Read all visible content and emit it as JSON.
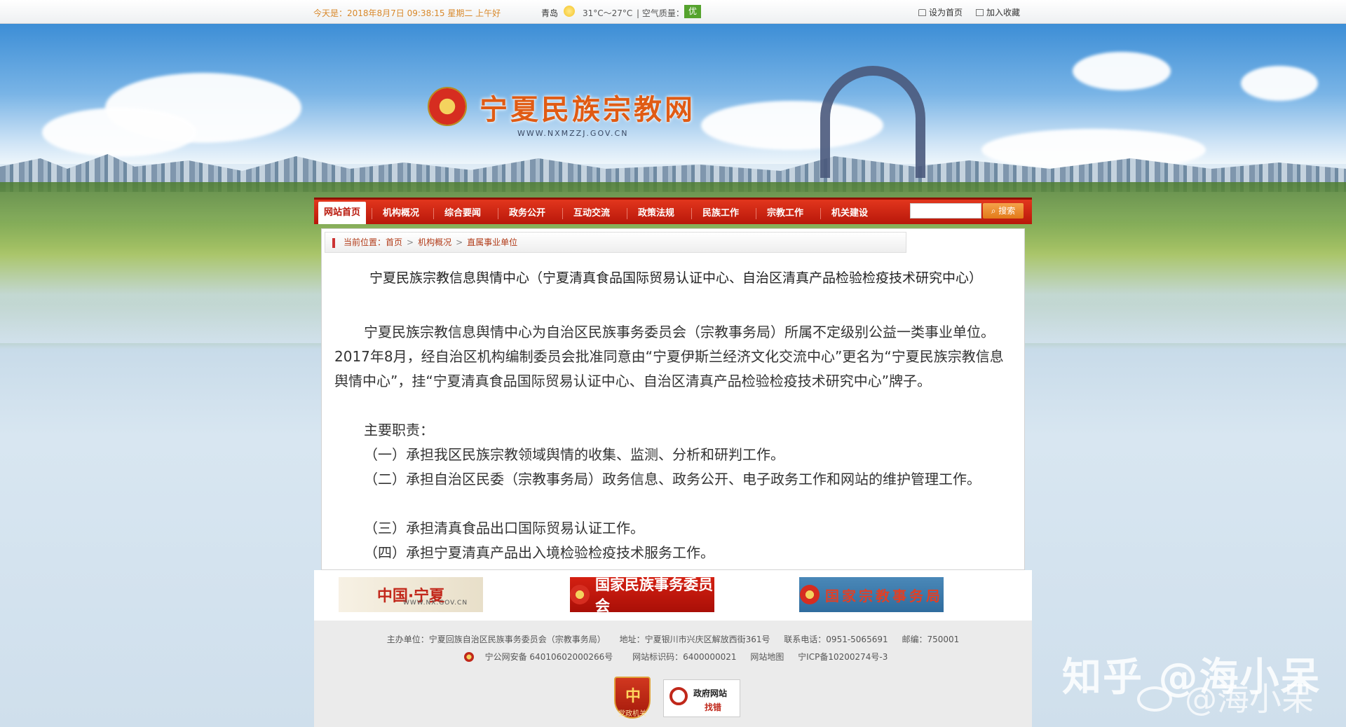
{
  "topbar": {
    "date": "今天是：2018年8月7日 09:38:15 星期二 上午好",
    "city": "青岛",
    "temperature": "31°C～27°C",
    "air_quality_label": "| 空气质量：",
    "air_quality_value": "优",
    "set_home": "设为首页",
    "add_favorite": "加入收藏"
  },
  "header": {
    "site_title": "宁夏民族宗教网",
    "site_url": "WWW.NXMZZJ.GOV.CN"
  },
  "nav": {
    "items": [
      "网站首页",
      "机构概况",
      "综合要闻",
      "政务公开",
      "互动交流",
      "政策法规",
      "民族工作",
      "宗教工作",
      "机关建设"
    ],
    "search_button": "搜索"
  },
  "breadcrumb": {
    "prefix": "当前位置：",
    "items": [
      "首页",
      "机构概况",
      "直属事业单位"
    ],
    "separator": ">"
  },
  "article": {
    "title": "宁夏民族宗教信息舆情中心（宁夏清真食品国际贸易认证中心、自治区清真产品检验检疫技术研究中心）",
    "paragraphs": [
      "宁夏民族宗教信息舆情中心为自治区民族事务委员会（宗教事务局）所属不定级别公益一类事业单位。2017年8月，经自治区机构编制委员会批准同意由“宁夏伊斯兰经济文化交流中心”更名为“宁夏民族宗教信息舆情中心”，挂“宁夏清真食品国际贸易认证中心、自治区清真产品检验检疫技术研究中心”牌子。",
      "主要职责：",
      "（一）承担我区民族宗教领域舆情的收集、监测、分析和研判工作。",
      "（二）承担自治区民委（宗教事务局）政务信息、政务公开、电子政务工作和网站的维护管理工作。",
      "（三）承担清真食品出口国际贸易认证工作。",
      "（四）承担宁夏清真产品出入境检验检疫技术服务工作。"
    ]
  },
  "partners": {
    "p1": "中国·宁夏",
    "p1_url": "WWW.NX.GOV.CN",
    "p2": "国家民族事务委员会",
    "p3": "国家宗教事务局"
  },
  "footer": {
    "sponsor": "主办单位：宁夏回族自治区民族事务委员会（宗教事务局）",
    "address": "地址：宁夏银川市兴庆区解放西街361号",
    "phone": "联系电话：0951-5065691",
    "postcode": "邮编：750001",
    "police": "宁公网安备 64010602000266号",
    "site_id": "网站标识码：6400000021",
    "sitemap": "网站地图",
    "icp": "宁ICP备10200274号-3",
    "badge_party_char": "中",
    "badge_party_label": "党政机关",
    "badge_gov_line1": "政府网站",
    "badge_gov_line2": "找错"
  },
  "watermark": {
    "line1": "知乎 @海小呆",
    "line2": "@海小呆"
  },
  "colors": {
    "nav_red": "#b8170a",
    "title_orange": "#e05b14",
    "date_orange": "#d8882a",
    "aq_green": "#55a32e"
  }
}
